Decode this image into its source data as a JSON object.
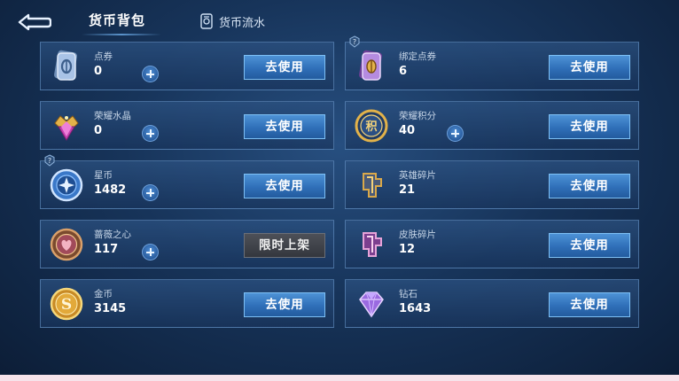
{
  "header": {
    "title": "货币背包",
    "history_tab": "货币流水"
  },
  "currencies": {
    "dianjuan": {
      "name": "点券",
      "value": "0",
      "action": "去使用"
    },
    "bangding": {
      "name": "绑定点券",
      "value": "6",
      "action": "去使用"
    },
    "shuijing": {
      "name": "荣耀水晶",
      "value": "0",
      "action": "去使用"
    },
    "jifen": {
      "name": "荣耀积分",
      "value": "40",
      "action": "去使用"
    },
    "xingbi": {
      "name": "星币",
      "value": "1482",
      "action": "去使用"
    },
    "yingxiong": {
      "name": "英雄碎片",
      "value": "21",
      "action": "去使用"
    },
    "qiangwei": {
      "name": "蔷薇之心",
      "value": "117",
      "action": "限时上架"
    },
    "pifu": {
      "name": "皮肤碎片",
      "value": "12",
      "action": "去使用"
    },
    "jinbi": {
      "name": "金币",
      "value": "3145",
      "action": "去使用"
    },
    "zuanshi": {
      "name": "钻石",
      "value": "1643",
      "action": "去使用"
    }
  },
  "icons": {
    "back": "back-arrow-icon",
    "history": "ledger-icon",
    "dianjuan": "voucher-card-icon",
    "bangding": "bound-voucher-icon",
    "shuijing": "crystal-icon",
    "jifen": "honor-points-icon",
    "xingbi": "star-coin-icon",
    "yingxiong": "hero-fragment-icon",
    "qiangwei": "rose-heart-coin-icon",
    "pifu": "skin-fragment-icon",
    "jinbi": "gold-coin-icon",
    "zuanshi": "diamond-icon",
    "help": "help-question-icon"
  },
  "colors": {
    "background": "#17345a",
    "card_border": "#6e9bcd",
    "button_primary": "#3a7fc6",
    "button_disabled": "#3f4249",
    "accent_gold": "#e2b24a",
    "accent_purple": "#9a4ccf"
  }
}
